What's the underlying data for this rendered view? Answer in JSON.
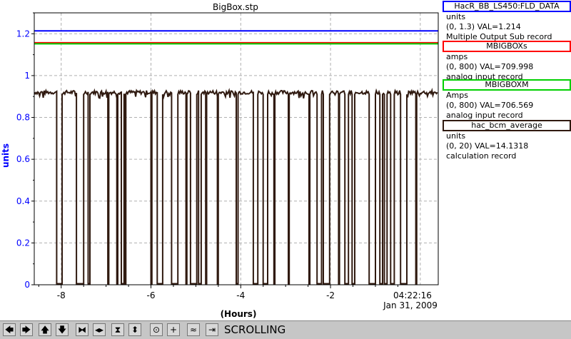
{
  "chart_data": {
    "type": "line",
    "title": "BigBox.stp",
    "xlabel": "(Hours)",
    "ylabel": "units",
    "xlim": [
      -8.6,
      0.4
    ],
    "ylim": [
      0,
      1.3
    ],
    "x_ticks": [
      "-8",
      "-6",
      "-4",
      "-2"
    ],
    "y_ticks": [
      "0",
      "0.2",
      "0.4",
      "0.6",
      "0.8",
      "1",
      "1.2"
    ],
    "time_label": "04:22:16",
    "date_label": "Jan 31, 2009",
    "grid": true,
    "series": [
      {
        "name": "HacR_BB_LS450:FLD_DATA",
        "color": "#0000ff",
        "constant": 1.214
      },
      {
        "name": "MBIGBOXs",
        "color": "#ff0000",
        "constant": 1.157
      },
      {
        "name": "MBIGBOXM",
        "color": "#00d000",
        "constant": 1.152
      },
      {
        "name": "hac_bcm_average",
        "color": "#301a10",
        "baseline": 0.92,
        "dropouts": [
          [
            -8.1,
            -7.98
          ],
          [
            -7.66,
            -7.5
          ],
          [
            -7.4,
            -7.36
          ],
          [
            -6.96,
            -6.94
          ],
          [
            -6.76,
            -6.74
          ],
          [
            -6.66,
            -6.6
          ],
          [
            -6.58,
            -6.56
          ],
          [
            -6.0,
            -5.98
          ],
          [
            -5.86,
            -5.74
          ],
          [
            -5.54,
            -5.4
          ],
          [
            -5.22,
            -5.2
          ],
          [
            -5.12,
            -4.98
          ],
          [
            -4.94,
            -4.88
          ],
          [
            -4.78,
            -4.76
          ],
          [
            -4.52,
            -4.5
          ],
          [
            -4.1,
            -4.06
          ],
          [
            -3.72,
            -3.62
          ],
          [
            -3.5,
            -3.4
          ],
          [
            -3.26,
            -3.24
          ],
          [
            -2.94,
            -2.92
          ],
          [
            -2.48,
            -2.46
          ],
          [
            -2.3,
            -2.2
          ],
          [
            -2.16,
            -2.02
          ],
          [
            -1.82,
            -1.8
          ],
          [
            -1.68,
            -1.6
          ],
          [
            -1.52,
            -1.46
          ],
          [
            -1.14,
            -1.0
          ],
          [
            -0.9,
            -0.84
          ],
          [
            -0.8,
            -0.74
          ],
          [
            -0.66,
            -0.58
          ],
          [
            -0.44,
            -0.3
          ],
          [
            -0.1,
            -0.08
          ]
        ]
      }
    ]
  },
  "legend": [
    {
      "title": "HacR_BB_LS450:FLD_DATA",
      "color": "#0000ff",
      "unit": "units",
      "range_val": "(0, 1.3) VAL=1.214",
      "record": "Multiple Output Sub record"
    },
    {
      "title": "MBIGBOXs",
      "color": "#ff0000",
      "unit": "amps",
      "range_val": "(0, 800) VAL=709.998",
      "record": "analog input record"
    },
    {
      "title": "MBIGBOXM",
      "color": "#00d000",
      "unit": "Amps",
      "range_val": "(0, 800) VAL=706.569",
      "record": "analog input record"
    },
    {
      "title": "hac_bcm_average",
      "color": "#301a10",
      "unit": "units",
      "range_val": "(0, 20) VAL=14.1318",
      "record": "calculation record"
    }
  ],
  "toolbar": {
    "buttons": [
      {
        "name": "pan-left-button",
        "icon": "arrow-left-icon",
        "glyph": "🡄"
      },
      {
        "name": "pan-right-button",
        "icon": "arrow-right-icon",
        "glyph": "🡆"
      },
      {
        "name": "pan-up-button",
        "icon": "arrow-up-icon",
        "glyph": "🡅"
      },
      {
        "name": "pan-down-button",
        "icon": "arrow-down-icon",
        "glyph": "🡇"
      },
      {
        "name": "zoom-in-x-button",
        "icon": "zoom-in-x-icon",
        "glyph": "⧓"
      },
      {
        "name": "zoom-out-x-button",
        "icon": "zoom-out-x-icon",
        "glyph": "◂▸"
      },
      {
        "name": "zoom-in-y-button",
        "icon": "zoom-in-y-icon",
        "glyph": "⧗"
      },
      {
        "name": "zoom-out-y-button",
        "icon": "zoom-out-y-icon",
        "glyph": "⬍"
      },
      {
        "name": "zoom-reset-button",
        "icon": "zoom-reset-icon",
        "glyph": "⊙"
      },
      {
        "name": "add-marker-button",
        "icon": "plus-icon",
        "glyph": "+"
      },
      {
        "name": "scroll-mode-button",
        "icon": "scroll-mode-icon",
        "glyph": "≈"
      },
      {
        "name": "jump-to-end-button",
        "icon": "jump-end-icon",
        "glyph": "⇥"
      }
    ],
    "status": "SCROLLING"
  }
}
